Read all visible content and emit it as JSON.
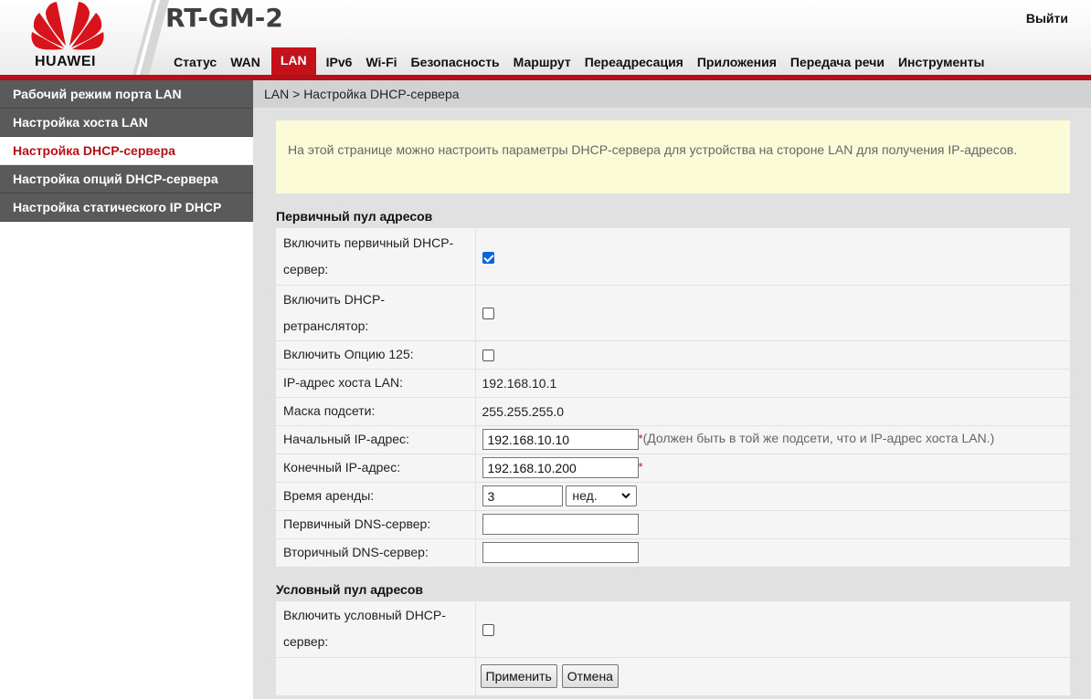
{
  "brand": {
    "logo_text": "HUAWEI",
    "accent": "#c3121b"
  },
  "header": {
    "title": "RT-GM-2",
    "logout_label": "Выйти",
    "nav": [
      "Статус",
      "WAN",
      "LAN",
      "IPv6",
      "Wi-Fi",
      "Безопасность",
      "Маршрут",
      "Переадресация",
      "Приложения",
      "Передача речи",
      "Инструменты"
    ],
    "active_nav": "LAN"
  },
  "sidebar": {
    "items": [
      {
        "label": "Рабочий режим порта LAN"
      },
      {
        "label": "Настройка хоста LAN"
      },
      {
        "label": "Настройка DHCP-сервера"
      },
      {
        "label": "Настройка опций DHCP-сервера"
      },
      {
        "label": "Настройка статического IP DHCP"
      }
    ],
    "active_item": "Настройка DHCP-сервера"
  },
  "main": {
    "breadcrumb": "LAN > Настройка DHCP-сервера",
    "info": "На этой странице можно настроить параметры DHCP-сервера для устройства на стороне LAN для получения IP-адресов.",
    "primary_pool": {
      "title": "Первичный пул адресов",
      "enable_primary_label": "Включить первичный DHCP-сервер:",
      "enable_primary": true,
      "enable_relay_label": "Включить DHCP-ретранслятор:",
      "enable_relay": false,
      "enable_option125_label": "Включить Опцию 125:",
      "enable_option125": false,
      "host_ip_label": "IP-адрес хоста LAN:",
      "host_ip": "192.168.10.1",
      "mask_label": "Маска подсети:",
      "mask": "255.255.255.0",
      "start_ip_label": "Начальный IP-адрес:",
      "start_ip": "192.168.10.10",
      "start_ip_hint": "(Должен быть в той же подсети, что и IP-адрес хоста LAN.)",
      "end_ip_label": "Конечный IP-адрес:",
      "end_ip": "192.168.10.200",
      "lease_label": "Время аренды:",
      "lease_value": "3",
      "lease_unit": "нед.",
      "dns1_label": "Первичный DNS-сервер:",
      "dns1": "",
      "dns2_label": "Вторичный DNS-сервер:",
      "dns2": ""
    },
    "conditional_pool": {
      "title": "Условный пул адресов",
      "enable_label": "Включить условный DHCP-сервер:",
      "enable": false
    },
    "buttons": {
      "apply": "Применить",
      "cancel": "Отмена"
    },
    "required_mark": "*"
  }
}
